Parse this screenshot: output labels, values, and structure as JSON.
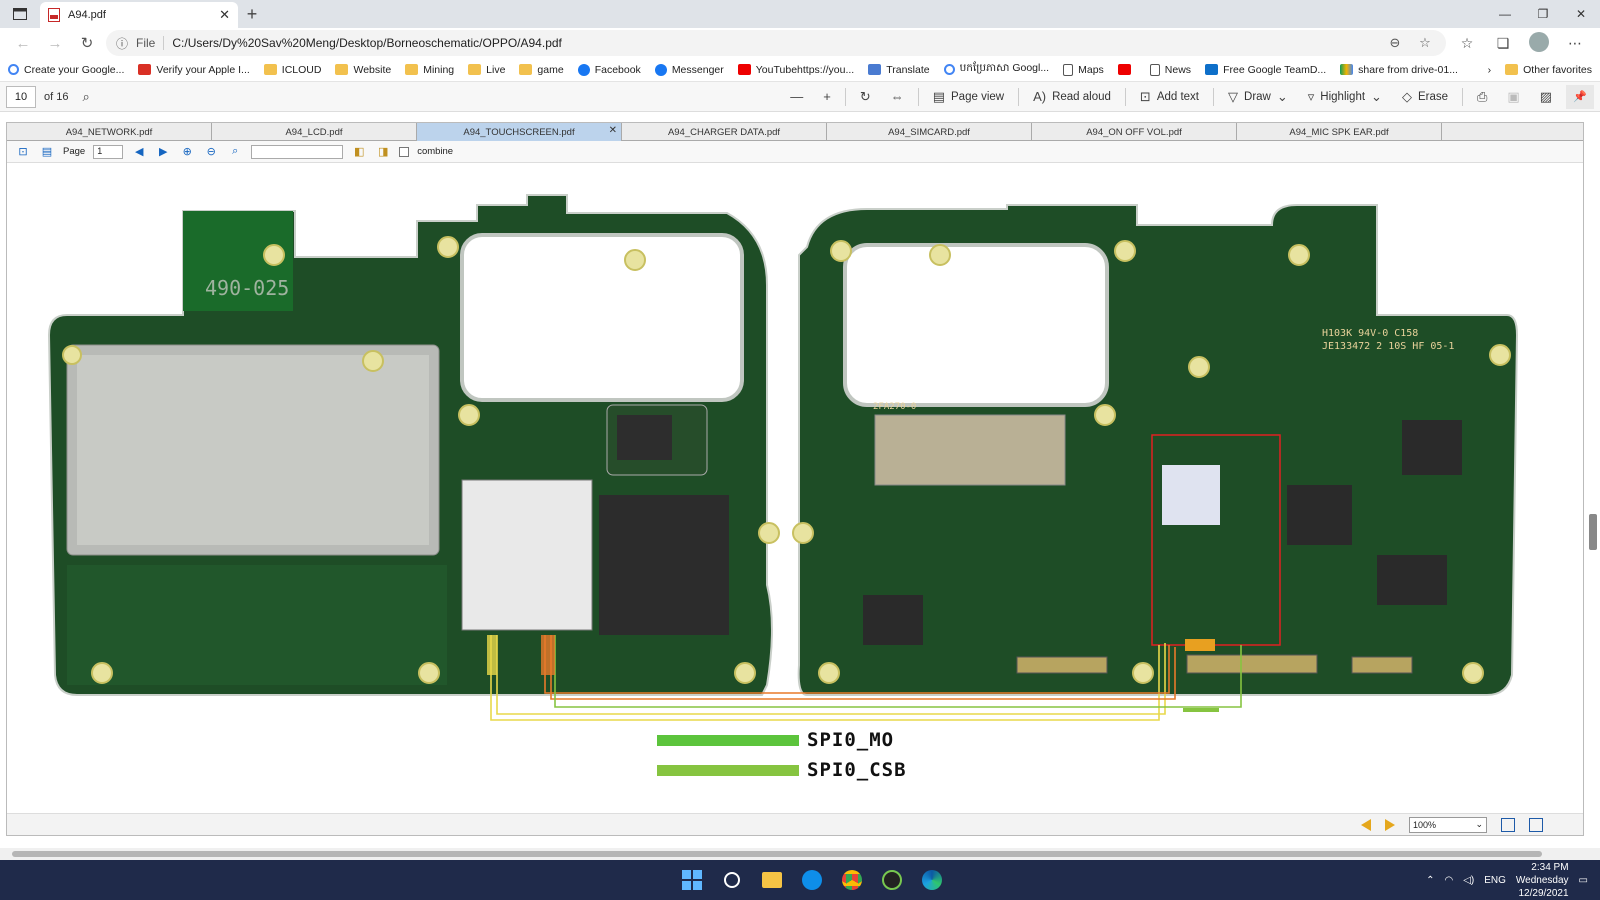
{
  "browser": {
    "tab_title": "A94.pdf",
    "url_prefix": "File",
    "url": "C:/Users/Dy%20Sav%20Meng/Desktop/Borneoschematic/OPPO/A94.pdf"
  },
  "bookmarks": [
    {
      "label": "Create your Google...",
      "icon": "g"
    },
    {
      "label": "Verify your Apple I...",
      "icon": "mail"
    },
    {
      "label": "ICLOUD",
      "icon": "folder"
    },
    {
      "label": "Website",
      "icon": "folder"
    },
    {
      "label": "Mining",
      "icon": "folder"
    },
    {
      "label": "Live",
      "icon": "folder"
    },
    {
      "label": "game",
      "icon": "folder"
    },
    {
      "label": "Facebook",
      "icon": "fb"
    },
    {
      "label": "Messenger",
      "icon": "fb"
    },
    {
      "label": "YouTubehttps://you...",
      "icon": "yt"
    },
    {
      "label": "Translate",
      "icon": "tr"
    },
    {
      "label": "បកប្រែភាសា Googl...",
      "icon": "g"
    },
    {
      "label": "Maps",
      "icon": "page"
    },
    {
      "label": "",
      "icon": "yt"
    },
    {
      "label": "News",
      "icon": "page"
    },
    {
      "label": "Free Google TeamD...",
      "icon": "tv"
    },
    {
      "label": "share from drive-01...",
      "icon": "drive"
    }
  ],
  "bookmarks_other": "Other favorites",
  "pdf_toolbar": {
    "page_current": "10",
    "page_total": "of 16",
    "page_view": "Page view",
    "read_aloud": "Read aloud",
    "add_text": "Add text",
    "draw": "Draw",
    "highlight": "Highlight",
    "erase": "Erase"
  },
  "doc_tabs": [
    "A94_NETWORK.pdf",
    "A94_LCD.pdf",
    "A94_TOUCHSCREEN.pdf",
    "A94_CHARGER DATA.pdf",
    "A94_SIMCARD.pdf",
    "A94_ON OFF VOL.pdf",
    "A94_MIC SPK EAR.pdf"
  ],
  "active_doc_tab": 2,
  "viewer_tools": {
    "page_label": "Page",
    "page_value": "1",
    "combine_label": "combine"
  },
  "board": {
    "left_marking": "490-025",
    "right_marking_1": "2FA270-0",
    "right_marking_2": "H103K 94V-0 C158",
    "right_marking_3": "JE133472 2 10S HF 05-1"
  },
  "legend": [
    {
      "label": "SPI0_MO",
      "color": "#5cc43c"
    },
    {
      "label": "SPI0_CSB",
      "color": "#86c440"
    }
  ],
  "zoom": "100%",
  "taskbar": {
    "time": "2:34 PM",
    "day": "Wednesday",
    "date": "12/29/2021",
    "lang": "ENG"
  }
}
